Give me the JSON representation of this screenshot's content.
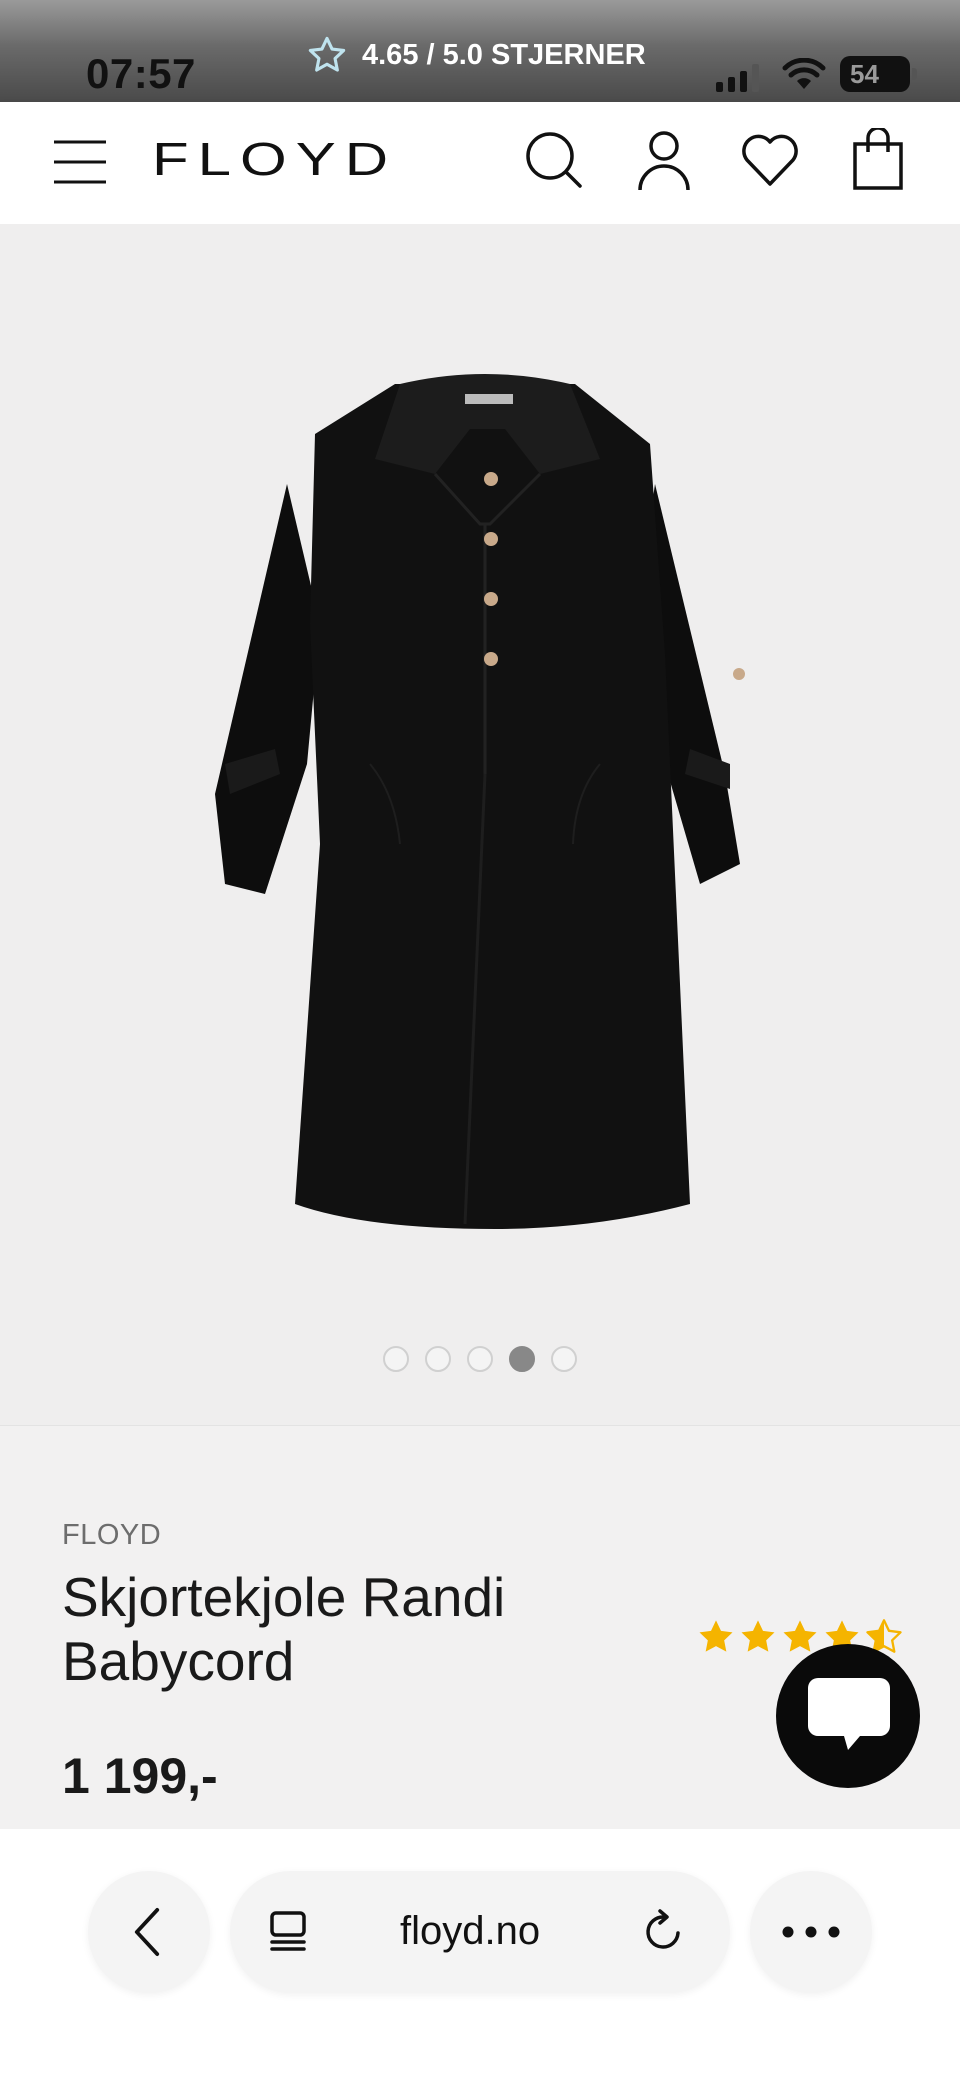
{
  "status_bar": {
    "time": "07:57",
    "rating_text": "4.65 / 5.0 STJERNER",
    "battery": "54"
  },
  "header": {
    "logo": "FLOYD",
    "icons": [
      "menu-icon",
      "search-icon",
      "account-icon",
      "heart-icon",
      "bag-icon"
    ]
  },
  "gallery": {
    "image_count": 5,
    "active_index": 3
  },
  "product": {
    "brand": "FLOYD",
    "title": "Skjortekjole Randi Babycord",
    "rating": 4.5,
    "rating_max": 5,
    "price": "1 199,-"
  },
  "browser": {
    "url": "floyd.no"
  },
  "colors": {
    "star": "#f5b400",
    "background": "#f2f1f1",
    "dress": "#0d0d0d"
  }
}
